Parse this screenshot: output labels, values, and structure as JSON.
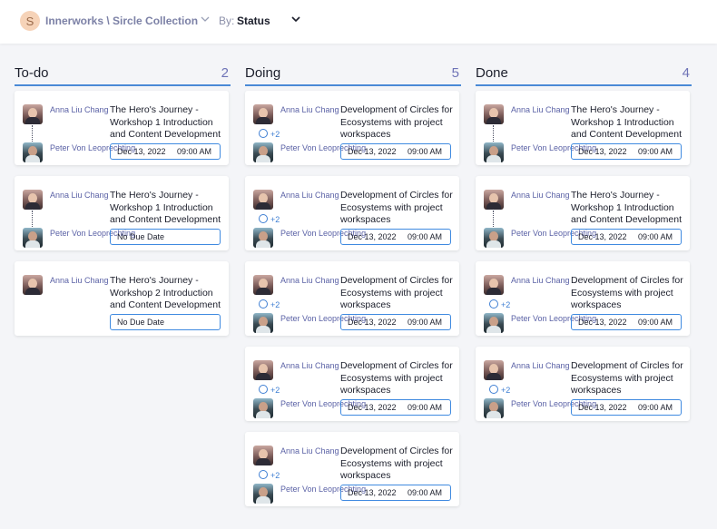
{
  "header": {
    "logo_letter": "S",
    "breadcrumb": "Innerworks \\ Sircle Collection",
    "by_label": "By:",
    "by_value": "Status"
  },
  "colors": {
    "accent": "#4a8ad6",
    "count": "#6e73b7",
    "name": "#5b62a6"
  },
  "columns": [
    {
      "title": "To-do",
      "count": "2",
      "cards": [
        {
          "owner": "Anna Liu Chang",
          "assignee": "Peter Von Leoprechting",
          "title": "The Hero's Journey - Workshop 1 Introduction and Content Development",
          "date": "Dec 13, 2022",
          "time": "09:00 AM",
          "more": ""
        },
        {
          "owner": "Anna Liu Chang",
          "assignee": "Peter Von Leoprechting",
          "title": "The Hero's Journey - Workshop 1 Introduction and Content Development",
          "no_due": "No Due Date",
          "more": ""
        },
        {
          "owner": "Anna Liu Chang",
          "assignee": "",
          "title": "The Hero's Journey - Workshop 2 Introduction and Content Development",
          "no_due": "No Due Date",
          "more": ""
        }
      ]
    },
    {
      "title": "Doing",
      "count": "5",
      "cards": [
        {
          "owner": "Anna Liu Chang",
          "assignee": "Peter Von Leoprechting",
          "title": "Development of Circles for Ecosystems with project workspaces",
          "date": "Dec 13, 2022",
          "time": "09:00 AM",
          "more": "+2"
        },
        {
          "owner": "Anna Liu Chang",
          "assignee": "Peter Von Leoprechting",
          "title": "Development of Circles for Ecosystems with project workspaces",
          "date": "Dec 13, 2022",
          "time": "09:00 AM",
          "more": "+2"
        },
        {
          "owner": "Anna Liu Chang",
          "assignee": "Peter Von Leoprechting",
          "title": "Development of Circles for Ecosystems with project workspaces",
          "date": "Dec 13, 2022",
          "time": "09:00 AM",
          "more": "+2"
        },
        {
          "owner": "Anna Liu Chang",
          "assignee": "Peter Von Leoprechting",
          "title": "Development of Circles for Ecosystems with project workspaces",
          "date": "Dec 13, 2022",
          "time": "09:00 AM",
          "more": "+2"
        },
        {
          "owner": "Anna Liu Chang",
          "assignee": "Peter Von Leoprechting",
          "title": "Development of Circles for Ecosystems with project workspaces",
          "date": "Dec 13, 2022",
          "time": "09:00 AM",
          "more": "+2"
        }
      ]
    },
    {
      "title": "Done",
      "count": "4",
      "cards": [
        {
          "owner": "Anna Liu Chang",
          "assignee": "Peter Von Leoprechting",
          "title": "The Hero's Journey - Workshop 1 Introduction and Content Development",
          "date": "Dec 13, 2022",
          "time": "09:00 AM",
          "more": ""
        },
        {
          "owner": "Anna Liu Chang",
          "assignee": "Peter Von Leoprechting",
          "title": "The Hero's Journey - Workshop 1 Introduction and Content Development",
          "date": "Dec 13, 2022",
          "time": "09:00 AM",
          "more": ""
        },
        {
          "owner": "Anna Liu Chang",
          "assignee": "Peter Von Leoprechting",
          "title": "Development of Circles for Ecosystems with project workspaces",
          "date": "Dec 13, 2022",
          "time": "09:00 AM",
          "more": "+2"
        },
        {
          "owner": "Anna Liu Chang",
          "assignee": "Peter Von Leoprechting",
          "title": "Development of Circles for Ecosystems with project workspaces",
          "date": "Dec 13, 2022",
          "time": "09:00 AM",
          "more": "+2"
        }
      ]
    }
  ]
}
